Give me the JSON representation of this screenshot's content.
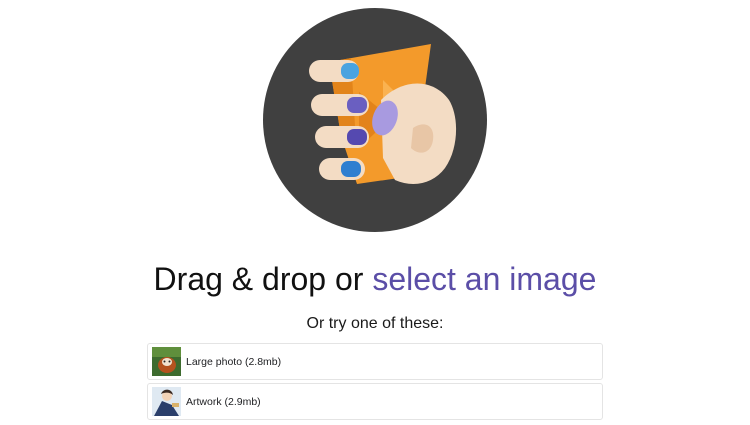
{
  "hero": {
    "icon": "hand-holding-image-icon",
    "circle_color": "#404040",
    "image_color": "#f39a2b",
    "nail_color": "#6a5fc1"
  },
  "headline": {
    "prefix": "Drag & drop or ",
    "link_label": "select an image",
    "link_color": "#5b4ea7"
  },
  "subhead": "Or try one of these:",
  "samples": [
    {
      "label": "Large photo (2.8mb)",
      "thumb_icon": "red-panda-photo-thumbnail"
    },
    {
      "label": "Artwork (2.9mb)",
      "thumb_icon": "artwork-illustration-thumbnail"
    }
  ]
}
